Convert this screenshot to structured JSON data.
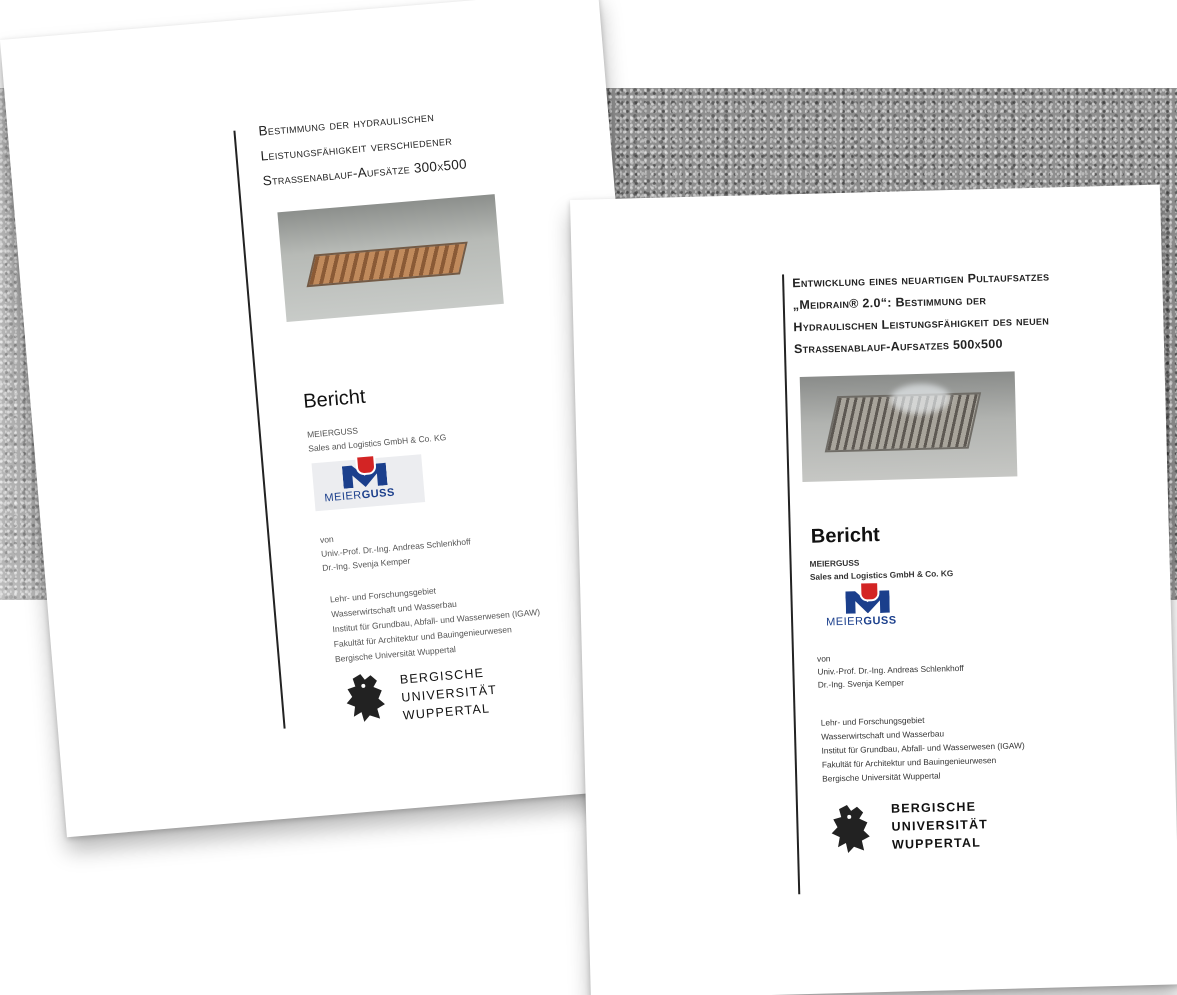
{
  "scene": {
    "background": "gravel",
    "colors": {
      "brand_blue": "#1b3f8c",
      "brand_red": "#d32424"
    }
  },
  "report_left": {
    "title_lines": [
      "Bestimmung der hydraulischen",
      "Leistungsfähigkeit verschiedener",
      "Straßenablauf-Aufsätze 300x500"
    ],
    "heading": "Bericht",
    "company_lines": [
      "MEIERGUSS",
      "Sales and Logistics GmbH & Co. KG"
    ],
    "logo_text_light": "MEIER",
    "logo_text_bold": "GUSS",
    "author_lines": [
      "von",
      "Univ.-Prof. Dr.-Ing. Andreas Schlenkhoff",
      "Dr.-Ing. Svenja Kemper"
    ],
    "department_lines": [
      "Lehr- und Forschungsgebiet",
      "Wasserwirtschaft und Wasserbau",
      "Institut für Grundbau, Abfall- und Wasserwesen (IGAW)",
      "Fakultät für Architektur und Bauingenieurwesen",
      "Bergische Universität Wuppertal"
    ],
    "university_lines": [
      "BERGISCHE",
      "UNIVERSITÄT",
      "WUPPERTAL"
    ]
  },
  "report_right": {
    "title_lines": [
      "Entwicklung eines neuartigen Pultaufsatzes",
      "„Meidrain® 2.0“: Bestimmung der",
      "Hydraulischen Leistungsfähigkeit des neuen",
      "Straßenablauf-Aufsatzes 500x500"
    ],
    "heading": "Bericht",
    "company_lines": [
      "MEIERGUSS",
      "Sales and Logistics GmbH & Co. KG"
    ],
    "logo_text_light": "MEIER",
    "logo_text_bold": "GUSS",
    "author_lines": [
      "von",
      "Univ.-Prof. Dr.-Ing. Andreas Schlenkhoff",
      "Dr.-Ing. Svenja Kemper"
    ],
    "department_lines": [
      "Lehr- und Forschungsgebiet",
      "Wasserwirtschaft und Wasserbau",
      "Institut für Grundbau, Abfall- und Wasserwesen (IGAW)",
      "Fakultät für Architektur und Bauingenieurwesen",
      "Bergische Universität Wuppertal"
    ],
    "university_lines": [
      "BERGISCHE",
      "UNIVERSITÄT",
      "WUPPERTAL"
    ]
  }
}
